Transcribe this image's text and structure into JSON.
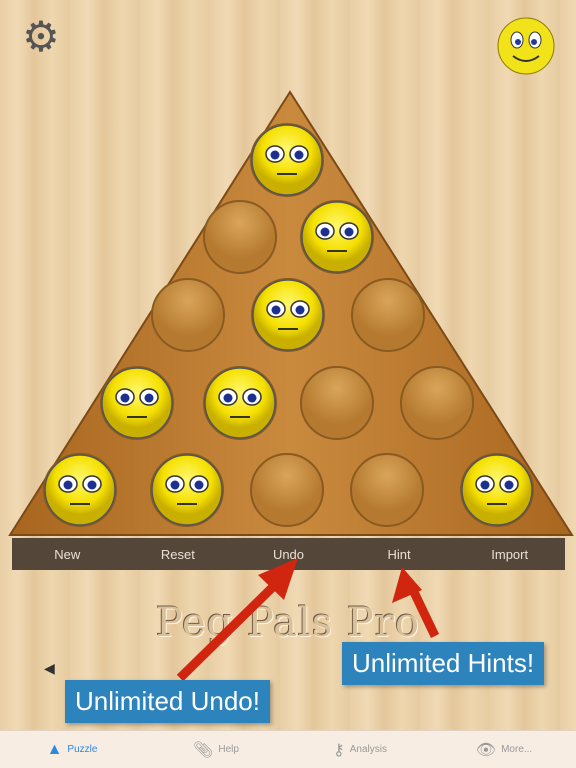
{
  "toolbar": {
    "new": "New",
    "reset": "Reset",
    "undo": "Undo",
    "hint": "Hint",
    "import": "Import"
  },
  "app_title": "Peg Pals Pro",
  "callouts": {
    "undo": "Unlimited Undo!",
    "hint": "Unlimited Hints!"
  },
  "tabs": [
    {
      "label": "Puzzle",
      "icon": "triangle-icon",
      "active": true
    },
    {
      "label": "Help",
      "icon": "paperclip-icon"
    },
    {
      "label": "Analysis",
      "icon": "key-icon"
    },
    {
      "label": "More...",
      "icon": "eye-icon"
    }
  ],
  "board": {
    "rows": [
      [
        1
      ],
      [
        0,
        1
      ],
      [
        0,
        1,
        0
      ],
      [
        1,
        1,
        0,
        0
      ],
      [
        1,
        1,
        0,
        0,
        1
      ]
    ]
  },
  "colors": {
    "accent": "#2a8ae0",
    "callout": "#2d83bb",
    "arrow": "#d0250f",
    "toolbar": "#55463a",
    "peg": "#f5e000"
  }
}
